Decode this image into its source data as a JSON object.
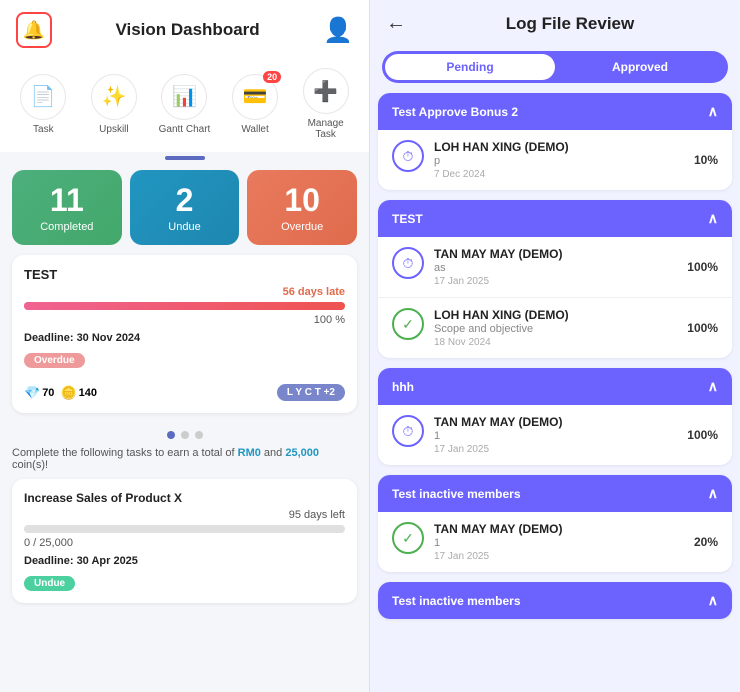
{
  "left": {
    "header": {
      "title": "Vision Dashboard"
    },
    "quick_icons": [
      {
        "id": "task",
        "symbol": "📄",
        "label": "Task",
        "badge": null
      },
      {
        "id": "upskill",
        "symbol": "✨",
        "label": "Upskill",
        "badge": null
      },
      {
        "id": "gantt",
        "symbol": "📊",
        "label": "Gantt Chart",
        "badge": null
      },
      {
        "id": "wallet",
        "symbol": "💳",
        "label": "Wallet",
        "badge": "20"
      },
      {
        "id": "manage",
        "symbol": "➕",
        "label": "Manage Task",
        "badge": null
      }
    ],
    "stats": [
      {
        "num": "11",
        "label": "Completed",
        "color": "green"
      },
      {
        "num": "2",
        "label": "Undue",
        "color": "teal"
      },
      {
        "num": "10",
        "label": "Overdue",
        "color": "coral"
      }
    ],
    "task_card": {
      "title": "TEST",
      "late_text": "56 days late",
      "progress_pct": "100 %",
      "deadline": "Deadline: 30 Nov 2024",
      "badge": "Overdue",
      "gems": "70",
      "coins": "140",
      "users": "L Y C T +2"
    },
    "earn_text": "Complete the following tasks to earn a total of ",
    "earn_rm": "RM0",
    "earn_and": " and ",
    "earn_coins": "25,000",
    "earn_suffix": " coin(s)!",
    "task_card2": {
      "title": "Increase Sales of Product X",
      "days_left": "95 days left",
      "progress": "0 / 25,000",
      "deadline": "Deadline: 30 Apr 2025",
      "badge": "Undue"
    }
  },
  "right": {
    "header": {
      "title": "Log File Review"
    },
    "tabs": [
      {
        "label": "Pending",
        "active": true
      },
      {
        "label": "Approved",
        "active": false
      }
    ],
    "sections": [
      {
        "title": "Test Approve Bonus 2",
        "entries": [
          {
            "icon_type": "clock",
            "name": "LOH HAN XING (DEMO)",
            "desc": "p",
            "date": "7 Dec 2024",
            "pct": "10%"
          }
        ]
      },
      {
        "title": "TEST",
        "entries": [
          {
            "icon_type": "clock",
            "name": "TAN MAY MAY (DEMO)",
            "desc": "as",
            "date": "17 Jan 2025",
            "pct": "100%"
          },
          {
            "icon_type": "check",
            "name": "LOH HAN XING (DEMO)",
            "desc": "Scope and objective",
            "date": "18 Nov 2024",
            "pct": "100%"
          }
        ]
      },
      {
        "title": "hhh",
        "entries": [
          {
            "icon_type": "clock",
            "name": "TAN MAY MAY (DEMO)",
            "desc": "1",
            "date": "17 Jan 2025",
            "pct": "100%"
          }
        ]
      },
      {
        "title": "Test inactive members",
        "entries": [
          {
            "icon_type": "check",
            "name": "TAN MAY MAY (DEMO)",
            "desc": "1",
            "date": "17 Jan 2025",
            "pct": "20%"
          }
        ]
      },
      {
        "title": "Test inactive members",
        "entries": []
      }
    ]
  }
}
